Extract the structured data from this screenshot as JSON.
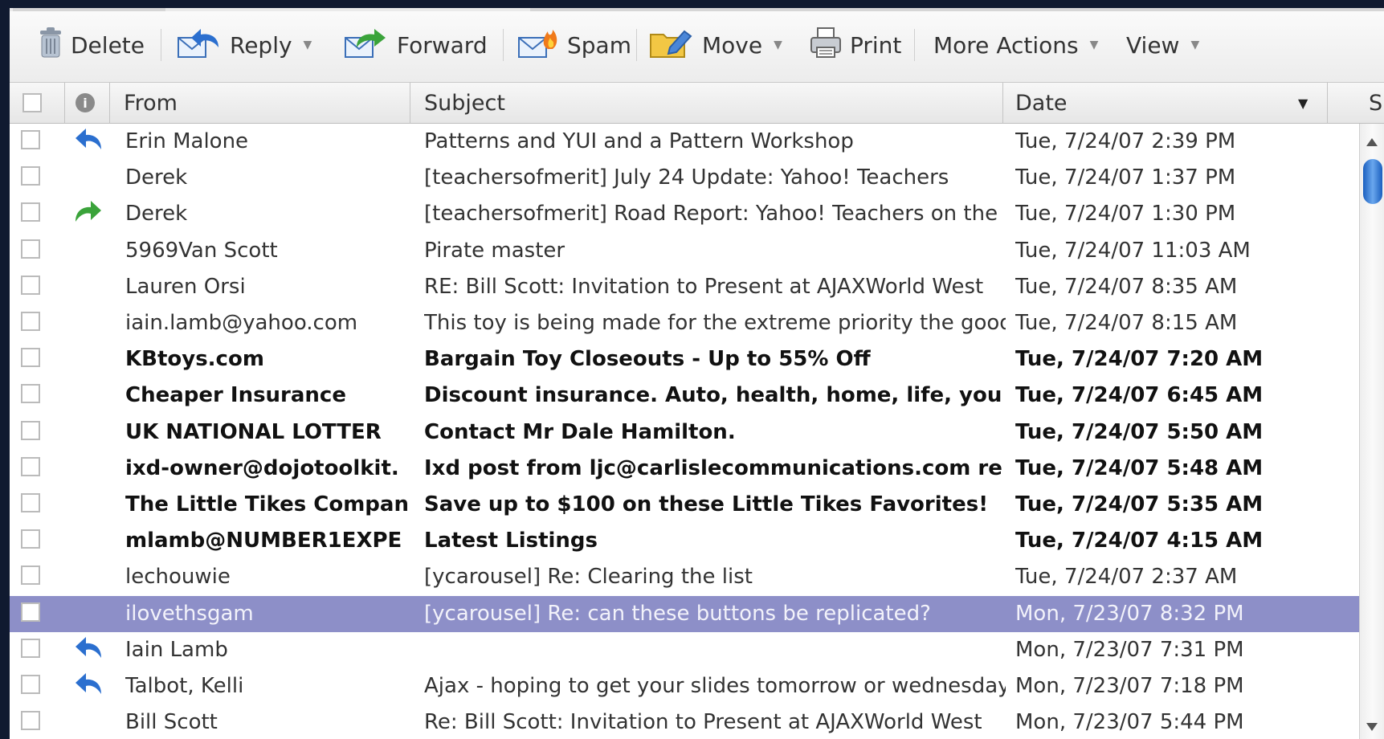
{
  "toolbar": {
    "delete_label": "Delete",
    "reply_label": "Reply",
    "forward_label": "Forward",
    "spam_label": "Spam",
    "move_label": "Move",
    "print_label": "Print",
    "more_actions_label": "More Actions",
    "view_label": "View"
  },
  "columns": {
    "from": "From",
    "subject": "Subject",
    "date": "Date",
    "size_partial": "S"
  },
  "messages": [
    {
      "from": "Erin Malone",
      "subject": "Patterns and YUI and a Pattern Workshop",
      "date": "Tue, 7/24/07 2:39 PM",
      "status": "replied",
      "unread": false,
      "selected": false
    },
    {
      "from": "Derek",
      "subject": "[teachersofmerit] July 24 Update: Yahoo! Teachers",
      "date": "Tue, 7/24/07 1:37 PM",
      "status": "",
      "unread": false,
      "selected": false
    },
    {
      "from": "Derek",
      "subject": "[teachersofmerit] Road Report: Yahoo! Teachers on the",
      "date": "Tue, 7/24/07 1:30 PM",
      "status": "forwarded",
      "unread": false,
      "selected": false
    },
    {
      "from": "5969Van Scott",
      "subject": "Pirate master",
      "date": "Tue, 7/24/07 11:03 AM",
      "status": "",
      "unread": false,
      "selected": false
    },
    {
      "from": "Lauren Orsi",
      "subject": "RE: Bill Scott: Invitation to Present at AJAXWorld West",
      "date": "Tue, 7/24/07 8:35 AM",
      "status": "",
      "unread": false,
      "selected": false
    },
    {
      "from": "iain.lamb@yahoo.com",
      "subject": "This toy is being made for the extreme priority the good",
      "date": "Tue, 7/24/07 8:15 AM",
      "status": "",
      "unread": false,
      "selected": false
    },
    {
      "from": "KBtoys.com",
      "subject": "Bargain Toy Closeouts - Up to 55% Off",
      "date": "Tue, 7/24/07 7:20 AM",
      "status": "",
      "unread": true,
      "selected": false
    },
    {
      "from": "Cheaper Insurance",
      "subject": "Discount insurance. Auto, health, home, life, you",
      "date": "Tue, 7/24/07 6:45 AM",
      "status": "",
      "unread": true,
      "selected": false
    },
    {
      "from": "UK NATIONAL LOTTER",
      "subject": "Contact Mr Dale Hamilton.",
      "date": "Tue, 7/24/07 5:50 AM",
      "status": "",
      "unread": true,
      "selected": false
    },
    {
      "from": "ixd-owner@dojotoolkit.",
      "subject": "Ixd post from ljc@carlislecommunications.com re",
      "date": "Tue, 7/24/07 5:48 AM",
      "status": "",
      "unread": true,
      "selected": false
    },
    {
      "from": "The Little Tikes Compan",
      "subject": "Save up to $100 on these Little Tikes Favorites!",
      "date": "Tue, 7/24/07 5:35 AM",
      "status": "",
      "unread": true,
      "selected": false
    },
    {
      "from": "mlamb@NUMBER1EXPE",
      "subject": "Latest Listings",
      "date": "Tue, 7/24/07 4:15 AM",
      "status": "",
      "unread": true,
      "selected": false
    },
    {
      "from": "lechouwie",
      "subject": "[ycarousel] Re: Clearing the list",
      "date": "Tue, 7/24/07 2:37 AM",
      "status": "",
      "unread": false,
      "selected": false
    },
    {
      "from": "ilovethsgam",
      "subject": "[ycarousel] Re: can these buttons be replicated?",
      "date": "Mon, 7/23/07 8:32 PM",
      "status": "",
      "unread": false,
      "selected": true
    },
    {
      "from": "Iain Lamb",
      "subject": "",
      "date": "Mon, 7/23/07 7:31 PM",
      "status": "replied",
      "unread": false,
      "selected": false
    },
    {
      "from": "Talbot, Kelli",
      "subject": "Ajax - hoping to get your slides tomorrow or wednesday",
      "date": "Mon, 7/23/07 7:18 PM",
      "status": "replied",
      "unread": false,
      "selected": false
    },
    {
      "from": "Bill Scott",
      "subject": "Re: Bill Scott: Invitation to Present at AJAXWorld West",
      "date": "Mon, 7/23/07 5:44 PM",
      "status": "",
      "unread": false,
      "selected": false
    }
  ],
  "colors": {
    "selected_row": "#8d8fc8",
    "reply_icon": "#2b6fcf",
    "forward_icon": "#3aa33a",
    "scroll_thumb": "#1a5fbf"
  }
}
